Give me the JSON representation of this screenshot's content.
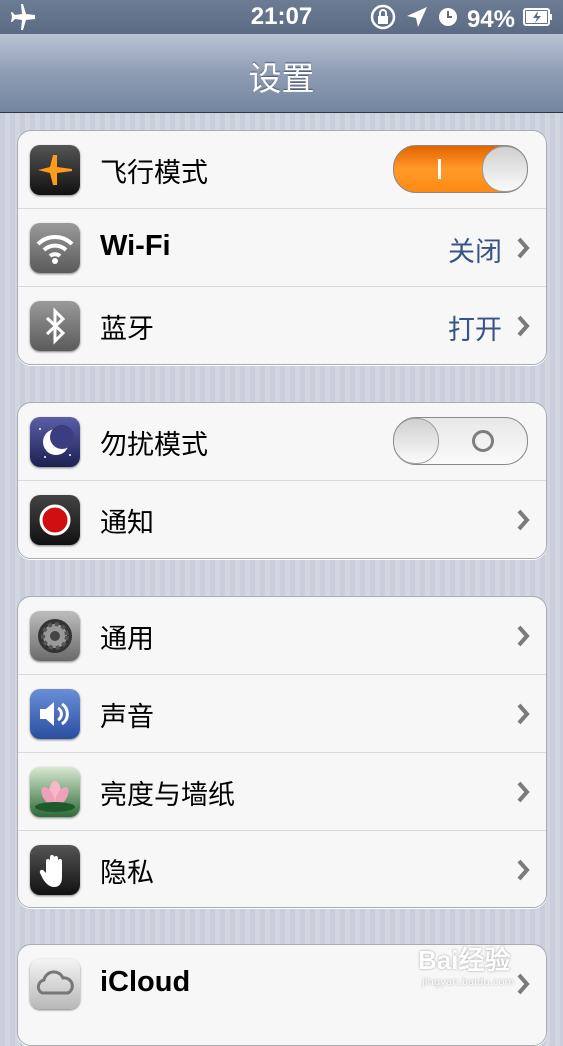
{
  "status_bar": {
    "time": "21:07",
    "battery": "94%",
    "icons": [
      "airplane-icon",
      "rotation-lock-icon",
      "location-icon",
      "alarm-icon",
      "battery-charging-icon"
    ]
  },
  "nav": {
    "title": "设置"
  },
  "groups": [
    {
      "rows": [
        {
          "label": "飞行模式",
          "icon": "airplane-mode-icon",
          "control": "toggle",
          "state": "on",
          "toggle_text": "I"
        },
        {
          "label": "Wi-Fi",
          "icon": "wifi-icon",
          "value": "关闭"
        },
        {
          "label": "蓝牙",
          "icon": "bluetooth-icon",
          "value": "打开"
        }
      ]
    },
    {
      "rows": [
        {
          "label": "勿扰模式",
          "icon": "moon-icon",
          "control": "toggle",
          "state": "off"
        },
        {
          "label": "通知",
          "icon": "notification-icon"
        }
      ]
    },
    {
      "rows": [
        {
          "label": "通用",
          "icon": "gear-icon"
        },
        {
          "label": "声音",
          "icon": "speaker-icon"
        },
        {
          "label": "亮度与墙纸",
          "icon": "flower-icon"
        },
        {
          "label": "隐私",
          "icon": "hand-icon"
        }
      ]
    },
    {
      "rows": [
        {
          "label": "iCloud",
          "icon": "cloud-icon"
        }
      ]
    }
  ],
  "watermark": {
    "text": "Bai经验",
    "subtext": "jingyan.baidu.com"
  },
  "colors": {
    "value_text": "#385487",
    "toggle_on": "#ff8a12"
  }
}
